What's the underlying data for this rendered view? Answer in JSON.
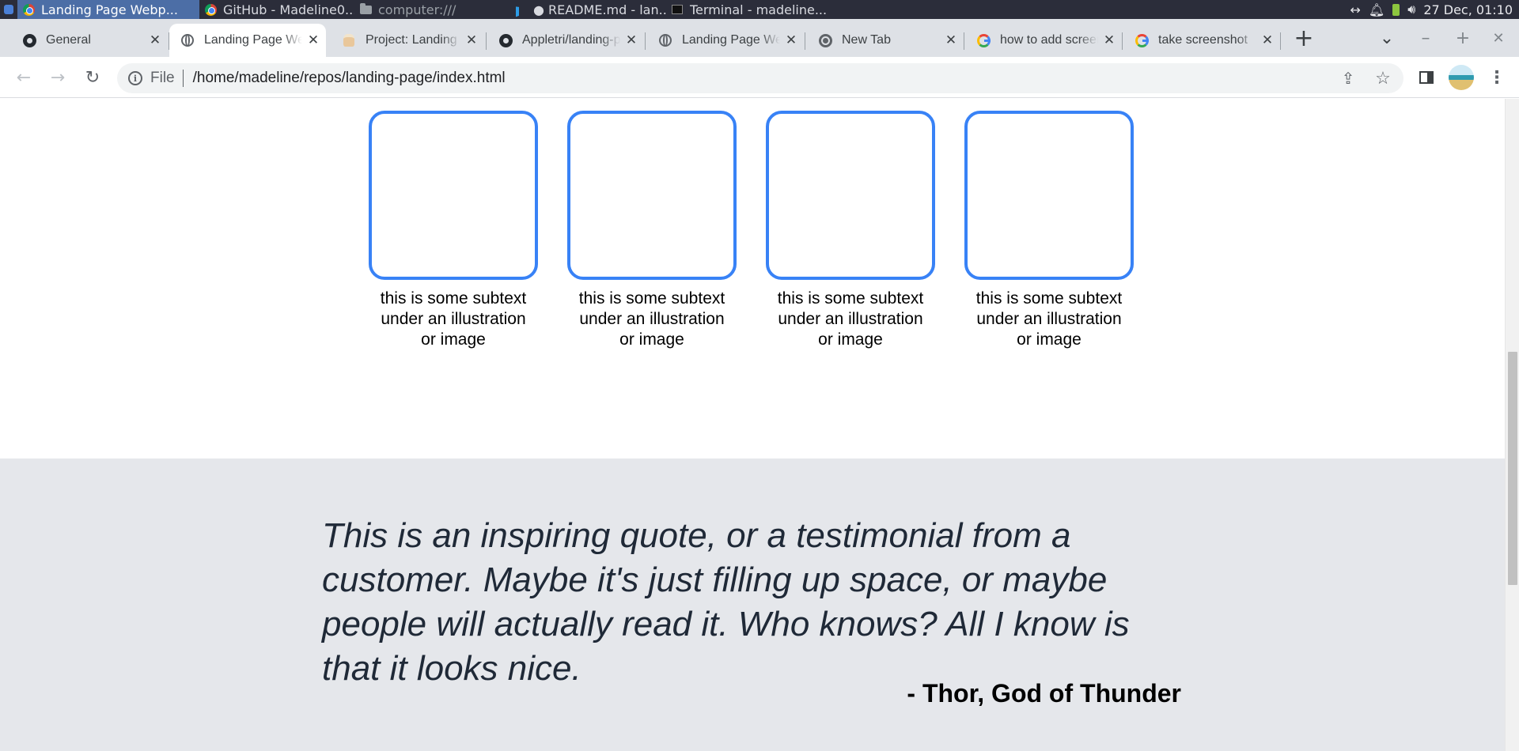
{
  "system_bar": {
    "tasks": [
      {
        "label": "Landing Page Webp...",
        "icon": "chrome-icon",
        "active": true
      },
      {
        "label": "GitHub - Madeline0...",
        "icon": "chrome-icon",
        "active": false
      },
      {
        "label": "computer:///",
        "icon": "folder-icon",
        "active": false
      },
      {
        "label": "● README.md - lan...",
        "icon": "vscode-icon",
        "active": false
      },
      {
        "label": "Terminal - madeline...",
        "icon": "terminal-icon",
        "active": false
      }
    ],
    "clock": "27 Dec, 01:10"
  },
  "browser": {
    "tabs": [
      {
        "title": "General",
        "favicon": "github-icon"
      },
      {
        "title": "Landing Page Webpage",
        "favicon": "globe-icon",
        "active": true
      },
      {
        "title": "Project: Landing Page",
        "favicon": "odin-icon"
      },
      {
        "title": "Appletri/landing-page",
        "favicon": "github-icon"
      },
      {
        "title": "Landing Page Webpage",
        "favicon": "globe-icon"
      },
      {
        "title": "New Tab",
        "favicon": "chrome-icon"
      },
      {
        "title": "how to add screenshot",
        "favicon": "google-icon"
      },
      {
        "title": "take screenshot",
        "favicon": "google-icon"
      }
    ],
    "close_glyph": "✕",
    "new_tab_glyph": "+",
    "tab_search_glyph": "⌄",
    "window_controls": {
      "minimize": "–",
      "maximize": "+",
      "close": "✕"
    },
    "address": {
      "scheme": "File",
      "url": "/home/madeline/repos/landing-page/index.html"
    }
  },
  "page": {
    "cards": [
      {
        "caption": "this is some subtext under an illustration or image"
      },
      {
        "caption": "this is some subtext under an illustration or image"
      },
      {
        "caption": "this is some subtext under an illustration or image"
      },
      {
        "caption": "this is some subtext under an illustration or image"
      }
    ],
    "quote": "This is an inspiring quote, or a testimonial from a customer. Maybe it's just filling up space, or maybe people will actually read it. Who knows? All I know is that it looks nice.",
    "quote_author": "- Thor, God of Thunder"
  },
  "colors": {
    "card_border": "#3882f6",
    "quote_background": "#e5e7eb",
    "quote_text": "#1f2937"
  }
}
